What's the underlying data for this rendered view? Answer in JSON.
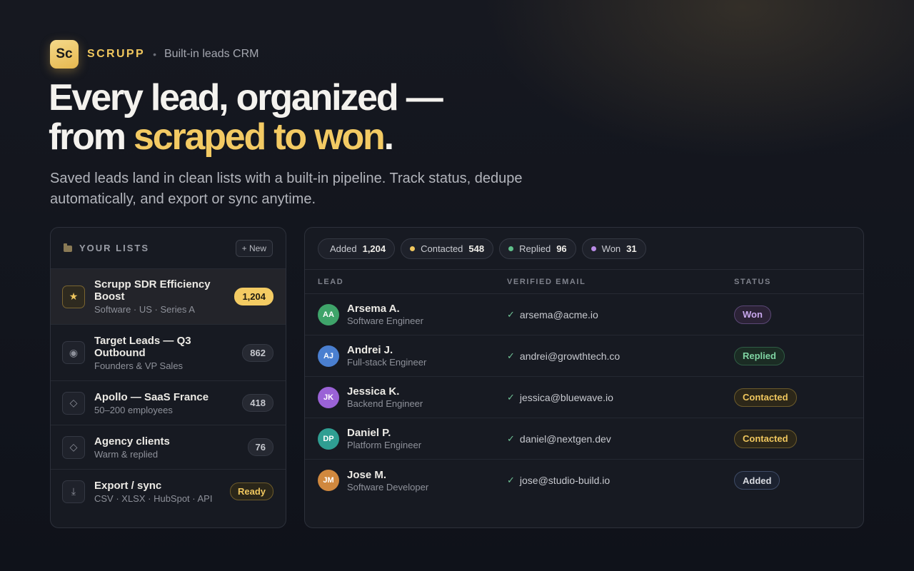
{
  "brand": {
    "logo": "Sc",
    "name": "SCRUPP",
    "separator": "•",
    "tagline": "Built-in leads CRM"
  },
  "headline": {
    "line1": "Every lead, organized —",
    "line2_prefix": "from ",
    "line2_accent": "scraped to won",
    "line2_suffix": "."
  },
  "subtitle": "Saved leads land in clean lists with a built-in pipeline. Track status, dedupe automatically, and export or sync anytime.",
  "lists": {
    "title": "YOUR LISTS",
    "new_label": "+ New",
    "items": [
      {
        "icon": "star-icon",
        "glyph": "★",
        "title": "Scrupp SDR Efficiency Boost",
        "sub": "Software · US · Series A",
        "count": "1,204",
        "style": "gold",
        "active": true
      },
      {
        "icon": "target-icon",
        "glyph": "◉",
        "title": "Target Leads — Q3 Outbound",
        "sub": "Founders & VP Sales",
        "count": "862",
        "style": "plain",
        "active": false
      },
      {
        "icon": "diamond-icon",
        "glyph": "◇",
        "title": "Apollo — SaaS France",
        "sub": "50–200 employees",
        "count": "418",
        "style": "plain",
        "active": false
      },
      {
        "icon": "diamond-icon",
        "glyph": "◇",
        "title": "Agency clients",
        "sub": "Warm & replied",
        "count": "76",
        "style": "plain",
        "active": false
      },
      {
        "icon": "download-icon",
        "glyph": "⤓",
        "title": "Export / sync",
        "sub": "CSV · XLSX · HubSpot · API",
        "count": "Ready",
        "style": "ready",
        "active": false
      }
    ]
  },
  "stats": [
    {
      "label": "Added",
      "value": "1,204",
      "color": ""
    },
    {
      "label": "Contacted",
      "value": "548",
      "color": "#f0c75e"
    },
    {
      "label": "Replied",
      "value": "96",
      "color": "#5fbf8a"
    },
    {
      "label": "Won",
      "value": "31",
      "color": "#b98be6"
    }
  ],
  "table": {
    "headers": {
      "lead": "LEAD",
      "email": "VERIFIED EMAIL",
      "status": "STATUS"
    },
    "rows": [
      {
        "initials": "AA",
        "avatar_color": "#3fa46a",
        "name": "Arsema A.",
        "role": "Software Engineer",
        "email": "arsema@acme.io",
        "status": "Won",
        "status_fg": "#c9a8ee",
        "status_bg": "#2b2236",
        "status_border": "#5a4775"
      },
      {
        "initials": "AJ",
        "avatar_color": "#4a7fd0",
        "name": "Andrei J.",
        "role": "Full-stack Engineer",
        "email": "andrei@growthtech.co",
        "status": "Replied",
        "status_fg": "#7fd4a2",
        "status_bg": "#1b2c24",
        "status_border": "#2f5c44"
      },
      {
        "initials": "JK",
        "avatar_color": "#9a62d6",
        "name": "Jessica K.",
        "role": "Backend Engineer",
        "email": "jessica@bluewave.io",
        "status": "Contacted",
        "status_fg": "#f0c75e",
        "status_bg": "#2c2719",
        "status_border": "#6b5a2b"
      },
      {
        "initials": "DP",
        "avatar_color": "#2f9e92",
        "name": "Daniel P.",
        "role": "Platform Engineer",
        "email": "daniel@nextgen.dev",
        "status": "Contacted",
        "status_fg": "#f0c75e",
        "status_bg": "#2c2719",
        "status_border": "#6b5a2b"
      },
      {
        "initials": "JM",
        "avatar_color": "#d0883e",
        "name": "Jose M.",
        "role": "Software Developer",
        "email": "jose@studio-build.io",
        "status": "Added",
        "status_fg": "#d8dae0",
        "status_bg": "#1c2230",
        "status_border": "#3e4b66"
      }
    ]
  }
}
